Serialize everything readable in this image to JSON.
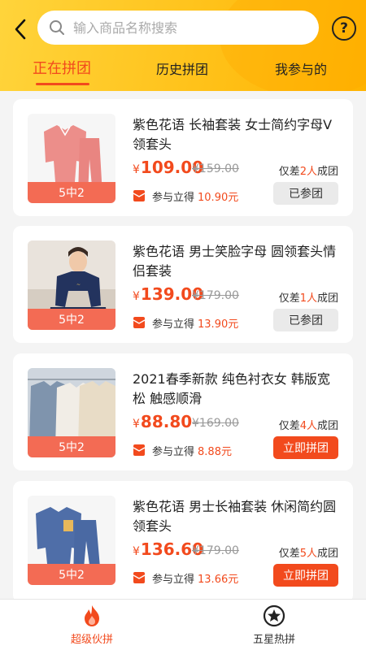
{
  "header": {
    "search_placeholder": "输入商品名称搜索",
    "help_symbol": "?"
  },
  "tabs": [
    {
      "label": "正在拼团",
      "active": true
    },
    {
      "label": "历史拼团",
      "active": false
    },
    {
      "label": "我参与的",
      "active": false
    }
  ],
  "products": [
    {
      "title": "紫色花语  长袖套装 女士简约字母V领套头",
      "yen": "¥",
      "price": "109.00",
      "orig_price": "¥159.00",
      "need_prefix": "仅差",
      "need_count": "2人",
      "need_suffix": "成团",
      "badge": "5中2",
      "cashback_label": "参与立得",
      "cashback_amount": "10.90元",
      "action": "已参团",
      "action_state": "joined",
      "image": "pink-pajama-set"
    },
    {
      "title": "紫色花语 男士笑脸字母 圆领套头情侣套装",
      "yen": "¥",
      "price": "139.00",
      "orig_price": "¥179.00",
      "need_prefix": "仅差",
      "need_count": "1人",
      "need_suffix": "成团",
      "badge": "5中2",
      "cashback_label": "参与立得",
      "cashback_amount": "13.90元",
      "action": "已参团",
      "action_state": "joined",
      "image": "navy-sweater-model"
    },
    {
      "title": "2021春季新款 纯色衬衣女  韩版宽松  触感顺滑",
      "yen": "¥",
      "price": "88.80",
      "orig_price": "¥169.00",
      "need_prefix": "仅差",
      "need_count": "4人",
      "need_suffix": "成团",
      "badge": "5中2",
      "cashback_label": "参与立得",
      "cashback_amount": "8.88元",
      "action": "立即拼团",
      "action_state": "join",
      "image": "shirts-on-hangers"
    },
    {
      "title": "紫色花语 男士长袖套装 休闲简约圆领套头",
      "yen": "¥",
      "price": "136.60",
      "orig_price": "¥179.00",
      "need_prefix": "仅差",
      "need_count": "5人",
      "need_suffix": "成团",
      "badge": "5中2",
      "cashback_label": "参与立得",
      "cashback_amount": "13.66元",
      "action": "立即拼团",
      "action_state": "join",
      "image": "blue-pajama-set"
    }
  ],
  "bottom_nav": [
    {
      "label": "超级伙拼",
      "icon": "flame-icon",
      "active": true
    },
    {
      "label": "五星热拼",
      "icon": "star-circle-icon",
      "active": false
    }
  ],
  "colors": {
    "accent": "#f24a1d",
    "header_yellow": "#ffc21a",
    "badge": "#f36b54"
  }
}
